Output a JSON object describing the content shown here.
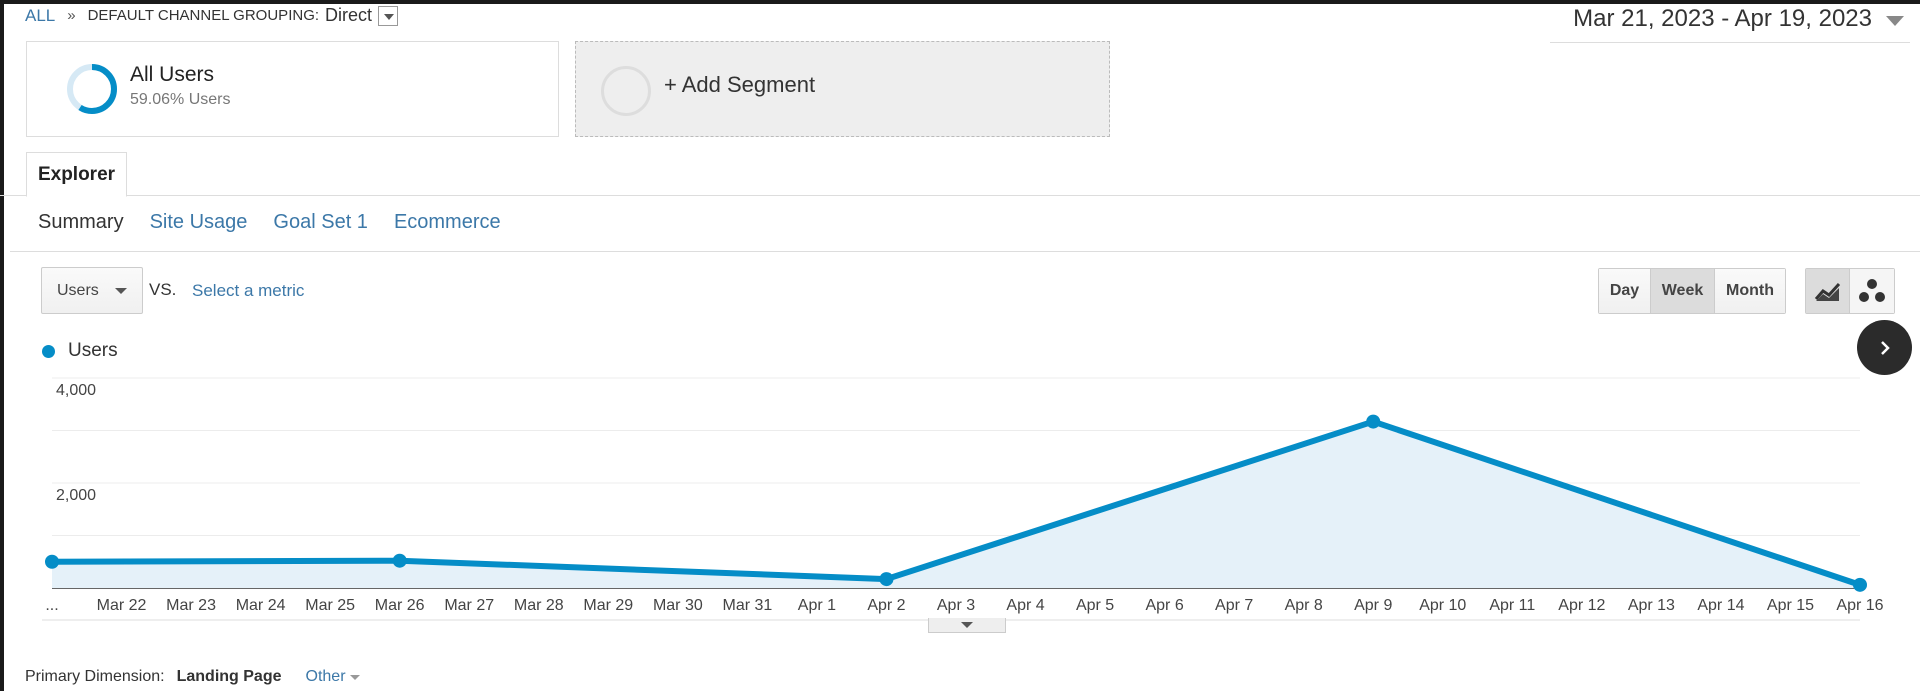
{
  "breadcrumb": {
    "root": "ALL",
    "separator": "»",
    "dimension": "DEFAULT CHANNEL GROUPING:",
    "value": "Direct"
  },
  "date_range": "Mar 21, 2023 - Apr 19, 2023",
  "segments": {
    "active": {
      "title": "All Users",
      "subtitle": "59.06% Users",
      "share": 0.5906
    },
    "add_label": "+ Add Segment"
  },
  "tabs": {
    "explorer": "Explorer"
  },
  "subtabs": [
    "Summary",
    "Site Usage",
    "Goal Set 1",
    "Ecommerce"
  ],
  "metric": {
    "selected": "Users",
    "vs": "VS.",
    "select_metric": "Select a metric"
  },
  "period": {
    "day": "Day",
    "week": "Week",
    "month": "Month",
    "selected": "Week"
  },
  "chart_type_icons": [
    "line-chart-icon",
    "motion-chart-icon"
  ],
  "legend": {
    "series": "Users",
    "color": "#058dc7"
  },
  "chart_data": {
    "type": "area",
    "x_labels": [
      "...",
      "Mar 22",
      "Mar 23",
      "Mar 24",
      "Mar 25",
      "Mar 26",
      "Mar 27",
      "Mar 28",
      "Mar 29",
      "Mar 30",
      "Mar 31",
      "Apr 1",
      "Apr 2",
      "Apr 3",
      "Apr 4",
      "Apr 5",
      "Apr 6",
      "Apr 7",
      "Apr 8",
      "Apr 9",
      "Apr 10",
      "Apr 11",
      "Apr 12",
      "Apr 13",
      "Apr 14",
      "Apr 15",
      "Apr 16"
    ],
    "points": [
      {
        "x": "...",
        "y": 500
      },
      {
        "x": "Mar 26",
        "y": 520
      },
      {
        "x": "Apr 2",
        "y": 170
      },
      {
        "x": "Apr 9",
        "y": 3170
      },
      {
        "x": "Apr 16",
        "y": 60
      }
    ],
    "y_ticks": [
      4000,
      2000
    ],
    "y_tick_labels": [
      "4,000",
      "2,000"
    ],
    "ylim": [
      0,
      4000
    ],
    "series": [
      {
        "name": "Users",
        "color": "#058dc7"
      }
    ],
    "grid": true
  },
  "primary_dimension": {
    "label": "Primary Dimension:",
    "value": "Landing Page",
    "other": "Other"
  }
}
